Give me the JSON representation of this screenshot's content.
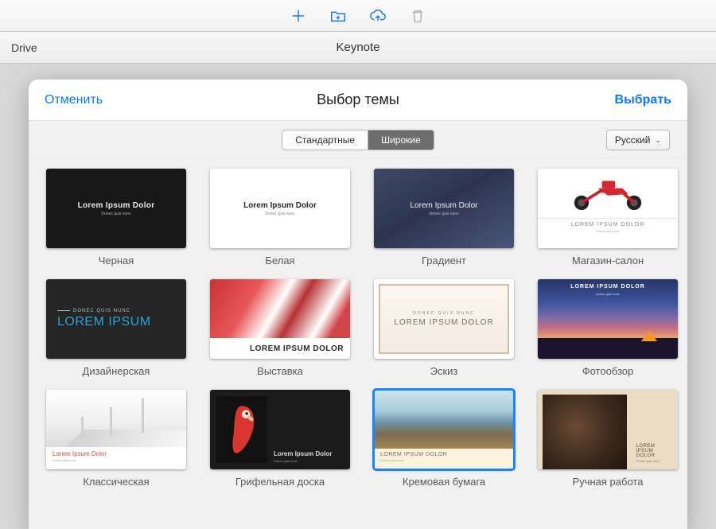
{
  "toolbar": {
    "icons": [
      "plus-icon",
      "new-folder-icon",
      "cloud-upload-icon",
      "trash-icon"
    ]
  },
  "header": {
    "left_label": "Drive",
    "app_title": "Keynote"
  },
  "panel": {
    "cancel_label": "Отменить",
    "choose_label": "Выбрать",
    "title": "Выбор темы",
    "segmented": {
      "standard": "Стандартные",
      "wide": "Широкие",
      "active": "wide"
    },
    "language": {
      "label": "Русский"
    }
  },
  "themes": [
    {
      "id": "black",
      "name": "Черная",
      "thumb_title": "Lorem Ipsum Dolor",
      "thumb_sub": "Donec quis nunc"
    },
    {
      "id": "white",
      "name": "Белая",
      "thumb_title": "Lorem Ipsum Dolor",
      "thumb_sub": "Donec quis nunc"
    },
    {
      "id": "gradient",
      "name": "Градиент",
      "thumb_title": "Lorem Ipsum Dolor",
      "thumb_sub": "Donec quis nunc"
    },
    {
      "id": "showroom",
      "name": "Магазин-салон",
      "thumb_title": "LOREM IPSUM DOLOR",
      "thumb_sub": "Donec quis nunc"
    },
    {
      "id": "designer",
      "name": "Дизайнерская",
      "thumb_title": "LOREM IPSUM",
      "thumb_sub": "DONEC QUIS NUNC"
    },
    {
      "id": "exhibit",
      "name": "Выставка",
      "thumb_title": "LOREM IPSUM DOLOR",
      "thumb_sub": ""
    },
    {
      "id": "sketch",
      "name": "Эскиз",
      "thumb_title": "LOREM IPSUM DOLOR",
      "thumb_sub": "DONEC QUIS NUNC"
    },
    {
      "id": "photo",
      "name": "Фотообзор",
      "thumb_title": "LOREM IPSUM DOLOR",
      "thumb_sub": "Donec quis nunc"
    },
    {
      "id": "classic",
      "name": "Классическая",
      "thumb_title": "Lorem Ipsum Dolor",
      "thumb_sub": "Donec quis nunc"
    },
    {
      "id": "slate",
      "name": "Грифельная доска",
      "thumb_title": "Lorem Ipsum Dolor",
      "thumb_sub": "Donec quis nunc"
    },
    {
      "id": "cream",
      "name": "Кремовая бумага",
      "thumb_title": "LOREM IPSUM DOLOR",
      "thumb_sub": "Donec quis nunc",
      "selected": true
    },
    {
      "id": "hand",
      "name": "Ручная работа",
      "thumb_title": "LOREM IPSUM DOLOR",
      "thumb_sub": "Donec quis nunc"
    }
  ]
}
